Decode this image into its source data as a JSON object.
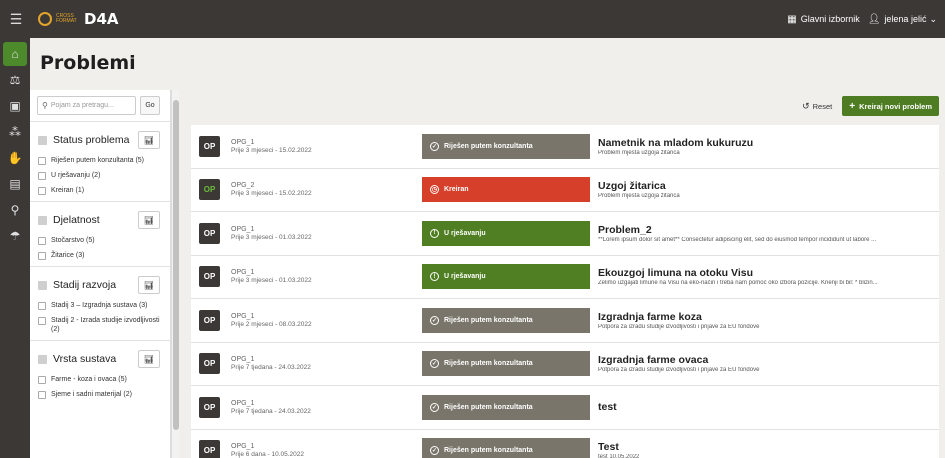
{
  "app": {
    "name": "D4A",
    "logo_text": "CROSS FORMAT"
  },
  "header": {
    "menu_label": "Glavni izbornik",
    "user_name": "jelena jelić"
  },
  "page": {
    "title": "Problemi"
  },
  "nav": {
    "icons": [
      "home-icon",
      "scale-icon",
      "briefcase-icon",
      "network-icon",
      "handshake-icon",
      "factory-icon",
      "search-icon",
      "helping-hand-icon"
    ]
  },
  "filters": {
    "search_placeholder": "Pojam za pretragu...",
    "go_label": "Go",
    "groups": [
      {
        "title": "Status problema",
        "options": [
          "Riješen putem konzultanta (5)",
          "U rješavanju (2)",
          "Kreiran (1)"
        ]
      },
      {
        "title": "Djelatnost",
        "options": [
          "Stočarstvo (5)",
          "Žitarice (3)"
        ]
      },
      {
        "title": "Stadij razvoja",
        "options": [
          "Stadij 3 – Izgradnja sustava (3)",
          "Stadij 2 - Izrada studije izvodljivosti\n(2)"
        ]
      },
      {
        "title": "Vrsta sustava",
        "options": [
          "Farme - koza i ovaca (5)",
          "Sjeme i sadni materijal (2)"
        ]
      }
    ]
  },
  "toolbar": {
    "reset_label": "Reset",
    "create_label": "Kreiraj novi problem"
  },
  "colors": {
    "accent": "#4d7c22",
    "header": "#3b3836",
    "status_gray": "#7a756a",
    "status_red": "#d63f2a",
    "status_green": "#4f7f22"
  },
  "problems": [
    {
      "avatar": "OP",
      "who": "OPG_1",
      "when": "Prije 3 mjeseci - 15.02.2022",
      "status": "Riješen putem konzultanta",
      "status_type": "gray",
      "title": "Nametnik na mladom kukuruzu",
      "desc": "Problem mjesta uzgoja žitarica"
    },
    {
      "avatar": "OP",
      "who": "OPG_2",
      "when": "Prije 3 mjeseci - 15.02.2022",
      "status": "Kreiran",
      "status_type": "red",
      "title": "Uzgoj žitarica",
      "desc": "Problem mjesta uzgoja žitarica"
    },
    {
      "avatar": "OP",
      "who": "OPG_1",
      "when": "Prije 3 mjeseci - 01.03.2022",
      "status": "U rješavanju",
      "status_type": "green",
      "title": "Problem_2",
      "desc": "**Lorem ipsum dolor sit amet** Consectetur adipiscing elit, sed do eiusmod tempor incididunt ut labore ..."
    },
    {
      "avatar": "OP",
      "who": "OPG_1",
      "when": "Prije 3 mjeseci - 01.03.2022",
      "status": "U rješavanju",
      "status_type": "green",
      "title": "Ekouzgoj limuna na otoku Visu",
      "desc": "Želimo uzgajati limune na Visu na eko-način i treba nam pomoć oko izbora pozicije. Krienji bi bil: * blizin..."
    },
    {
      "avatar": "OP",
      "who": "OPG_1",
      "when": "Prije 2 mjeseci - 08.03.2022",
      "status": "Riješen putem konzultanta",
      "status_type": "gray",
      "title": "Izgradnja farme koza",
      "desc": "Potpora za izradu studije izvodljivosti i prijave za EU fondove"
    },
    {
      "avatar": "OP",
      "who": "OPG_1",
      "when": "Prije 7 tjedana - 24.03.2022",
      "status": "Riješen putem konzultanta",
      "status_type": "gray",
      "title": "Izgradnja farme ovaca",
      "desc": "Potpora za izradu studije izvodljivosti i prijave za EU fondove"
    },
    {
      "avatar": "OP",
      "who": "OPG_1",
      "when": "Prije 7 tjedana - 24.03.2022",
      "status": "Riješen putem konzultanta",
      "status_type": "gray",
      "title": "test",
      "desc": ""
    },
    {
      "avatar": "OP",
      "who": "OPG_1",
      "when": "Prije 6 dana - 10.05.2022",
      "status": "Riješen putem konzultanta",
      "status_type": "gray",
      "title": "Test",
      "desc": "test 10.05.2022"
    }
  ]
}
